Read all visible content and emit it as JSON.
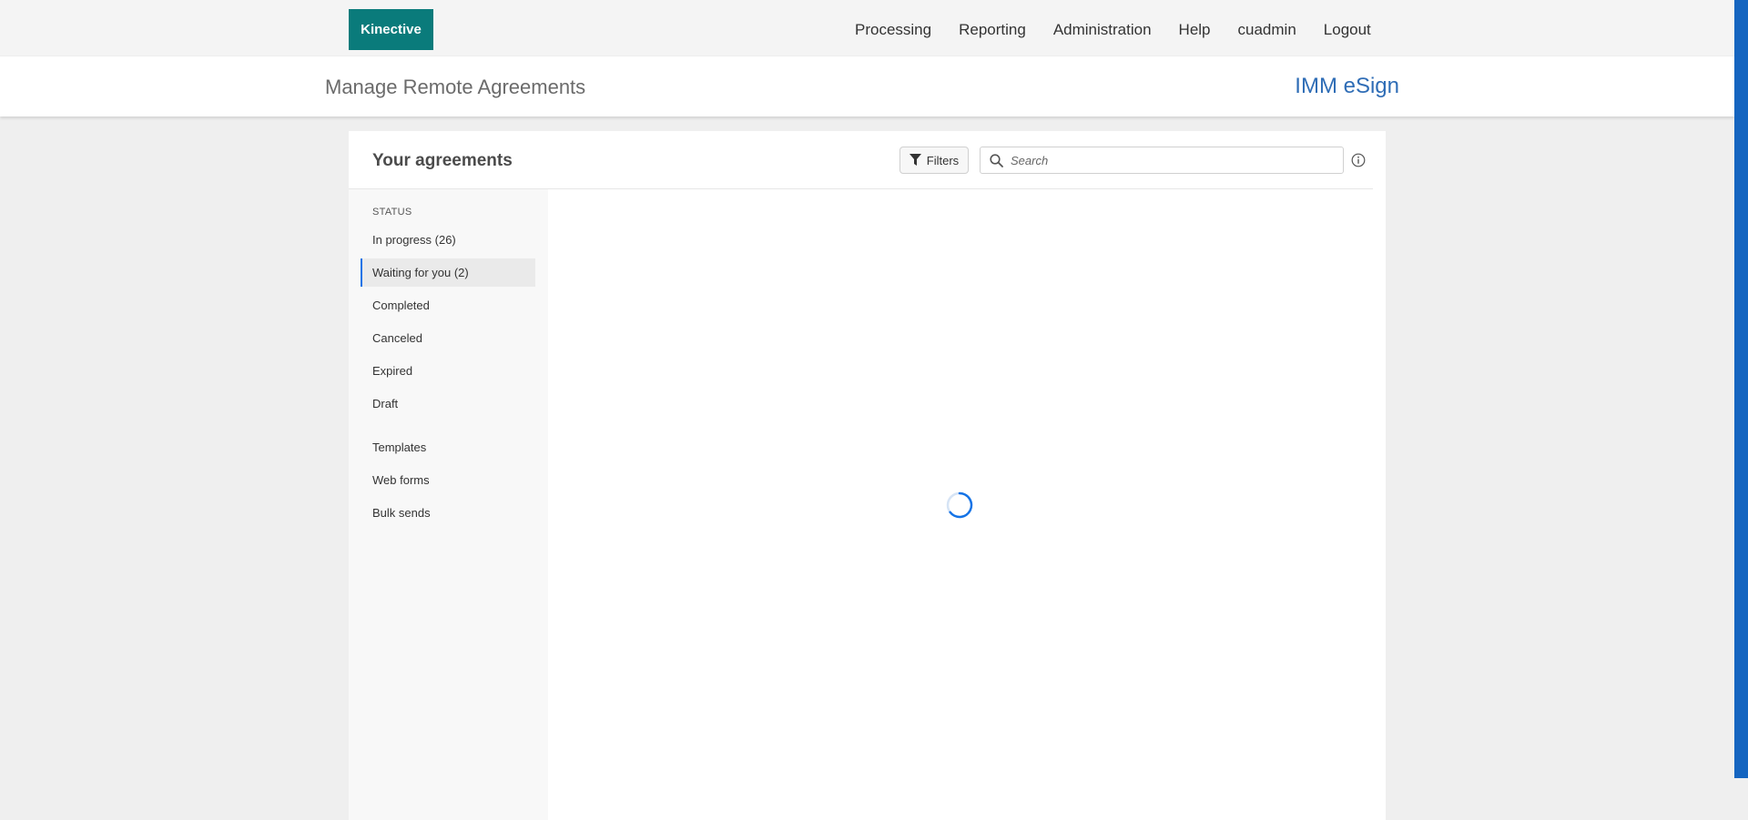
{
  "brand": {
    "label": "Kinective"
  },
  "nav": {
    "items": [
      {
        "label": "Processing"
      },
      {
        "label": "Reporting"
      },
      {
        "label": "Administration"
      },
      {
        "label": "Help"
      },
      {
        "label": "cuadmin"
      },
      {
        "label": "Logout"
      }
    ]
  },
  "subheader": {
    "page_title": "Manage Remote Agreements",
    "app_title": "IMM eSign"
  },
  "panel": {
    "title": "Your agreements",
    "filters_label": "Filters",
    "search_placeholder": "Search"
  },
  "sidebar": {
    "heading": "STATUS",
    "items": [
      {
        "label": "In progress (26)",
        "active": false
      },
      {
        "label": "Waiting for you (2)",
        "active": true
      },
      {
        "label": "Completed",
        "active": false
      },
      {
        "label": "Canceled",
        "active": false
      },
      {
        "label": "Expired",
        "active": false
      },
      {
        "label": "Draft",
        "active": false
      },
      {
        "label": "Templates",
        "active": false
      },
      {
        "label": "Web forms",
        "active": false
      },
      {
        "label": "Bulk sends",
        "active": false
      }
    ]
  },
  "colors": {
    "brand": "#0a7b7b",
    "app_title": "#2f6db6",
    "active_indicator": "#1473e6",
    "edge_bar": "#1565c0",
    "spinner": "#1473e6"
  },
  "icons": {
    "filter": "filter-icon",
    "search": "search-icon",
    "info": "info-icon",
    "spinner": "loading-spinner-icon"
  }
}
